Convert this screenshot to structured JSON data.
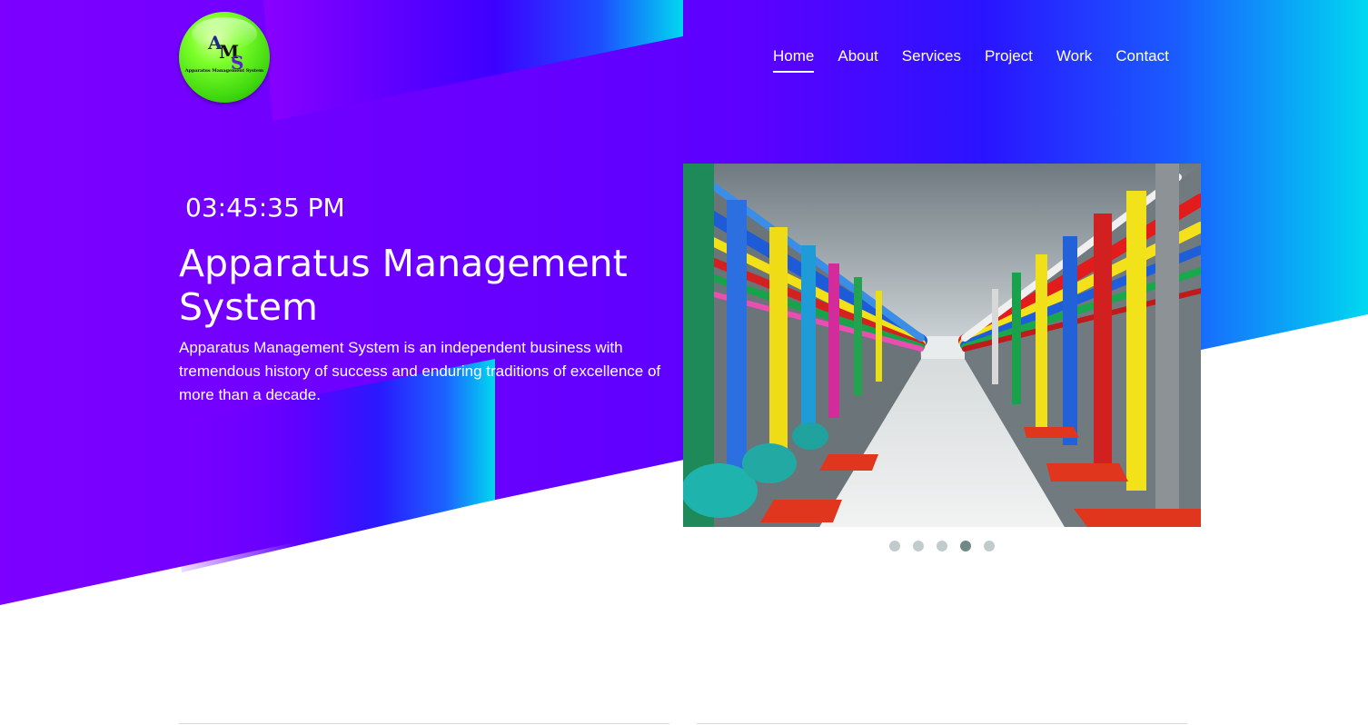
{
  "brand": {
    "logo_letters": [
      "A",
      "M",
      "S"
    ],
    "logo_text": "Apparatus Management System"
  },
  "nav": {
    "items": [
      {
        "label": "Home",
        "active": true
      },
      {
        "label": "About",
        "active": false
      },
      {
        "label": "Services",
        "active": false
      },
      {
        "label": "Project",
        "active": false
      },
      {
        "label": "Work",
        "active": false
      },
      {
        "label": "Contact",
        "active": false
      }
    ]
  },
  "hero": {
    "clock": "03:45:35 PM",
    "title": "Apparatus Management System",
    "description": "Apparatus Management System is an independent business with tremendous history of success and enduring traditions of excellence of more than a decade."
  },
  "slider": {
    "slide_count": 5,
    "active_index": 3,
    "image_subject": "industrial-plant-colorful-pipes"
  },
  "colors": {
    "gradient_purple": "#7d00ff",
    "gradient_blue": "#3311ff",
    "gradient_cyan": "#00d7f0",
    "dot_inactive": "#c2cbcb",
    "dot_active": "#6f8a86"
  }
}
